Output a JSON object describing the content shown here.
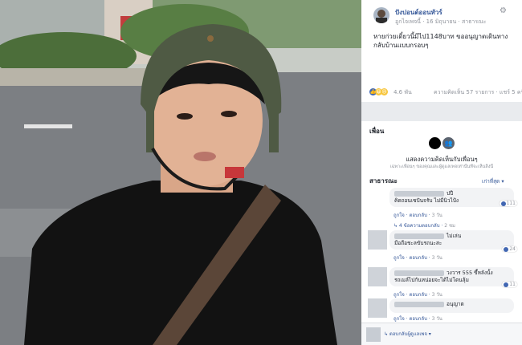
{
  "post": {
    "author": "ปังปอนด์ออนทัวร์",
    "date": "16 มิถุนายน",
    "privacy": "สาธารณะ",
    "author_short": "อูกไจเพจนี้",
    "text": "หายก่วยเดี๋ยวนี้มีไป1148บาท ขออนุญาตเดินทางกลับบ้านแบบกรอบๆ",
    "reaction_count": "4.6 พัน",
    "comments_shares": "ความคิดเห็น 57 รายการ · แชร์ 5 ครั้ง"
  },
  "friends": {
    "title": "เพื่อน",
    "caption": "แสดงความคิดเห็นกับเพื่อนๆ",
    "subcaption": "เฉพาะเพื่อนๆ ของคุณและผู้ดูแลเพจเท่านั้นที่จะเห็นสิ่งนี้"
  },
  "public": {
    "title": "สาธารณะ",
    "sort_label": "เก่าที่สุด ▾"
  },
  "comments": [
    {
      "text": "คิดถอนเซปันจรับ ไม่มีนิวไป้ง",
      "name_tail": "ปปี",
      "like": "ถูกใจ",
      "reply": "ตอบกลับ",
      "time": "3 วัน",
      "reactions": "111",
      "replies": "↳ 4 ข้อความตอบกลับ"
    },
    {
      "text": "มือถือชะลขับรถนะสะ",
      "name_tail": "ไม่เล่น",
      "like": "ถูกใจ",
      "reply": "ตอบกลับ",
      "time": "3 วัน",
      "reactions": "24"
    },
    {
      "text": "รถเมล์ไปกันหน่อยจะได้ไม่โดนลุ้ม",
      "name_tail": "วงวาร 555 ขึ้หลังนั้ง",
      "like": "ถูกใจ",
      "reply": "ตอบกลับ",
      "time": "3 วัน",
      "reactions": "11"
    },
    {
      "text": "",
      "name_tail": "อนุญาต",
      "like": "ถูกใจ",
      "reply": "ตอบกลับ",
      "time": "3 วัน",
      "reactions": ""
    }
  ],
  "reply_box": {
    "label": "↳ ตอบกลับผู้ดูแลเพจ ▾",
    "extra": "2 ชม"
  }
}
